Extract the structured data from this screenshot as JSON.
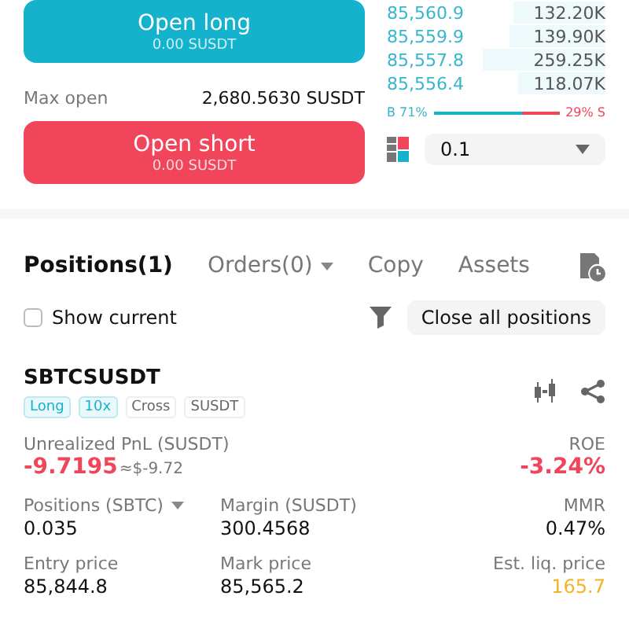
{
  "open_long": {
    "label": "Open long",
    "amount": "0.00 SUSDT"
  },
  "max_open": {
    "label": "Max open",
    "value": "2,680.5630 SUSDT"
  },
  "open_short": {
    "label": "Open short",
    "amount": "0.00 SUSDT"
  },
  "order_book": [
    {
      "price": "85,560.9",
      "size": "132.20K"
    },
    {
      "price": "85,559.9",
      "size": "139.90K"
    },
    {
      "price": "85,557.8",
      "size": "259.25K"
    },
    {
      "price": "85,556.4",
      "size": "118.07K"
    }
  ],
  "ratio": {
    "buy": "B 71%",
    "sell": "29% S",
    "level": 0.71
  },
  "precision": {
    "value": "0.1"
  },
  "tabs": [
    {
      "label": "Positions(1)",
      "selected": true,
      "dropdown": false
    },
    {
      "label": "Orders(0)",
      "selected": false,
      "dropdown": true
    },
    {
      "label": "Copy",
      "selected": false,
      "dropdown": false
    },
    {
      "label": "Assets",
      "selected": false,
      "dropdown": false
    }
  ],
  "show_current": {
    "label": "Show current",
    "checked": false
  },
  "close_all": "Close all positions",
  "position": {
    "symbol": "SBTCSUSDT",
    "tags": [
      {
        "label": "Long",
        "kind": "accent"
      },
      {
        "label": "10x",
        "kind": "accent"
      },
      {
        "label": "Cross",
        "kind": "plain"
      },
      {
        "label": "SUSDT",
        "kind": "plain"
      }
    ],
    "pnl_label": "Unrealized PnL (SUSDT)",
    "pnl": "-9.7195",
    "pnl_usd": "≈$-9.72",
    "roe_label": "ROE",
    "roe": "-3.24%",
    "fields": [
      {
        "label": "Positions (SBTC)",
        "value": "0.035",
        "dropdown": true,
        "kind": "plain"
      },
      {
        "label": "Margin (SUSDT)",
        "value": "300.4568",
        "dropdown": false,
        "kind": "plain"
      },
      {
        "label": "MMR",
        "value": "0.47%",
        "dropdown": false,
        "kind": "plain"
      },
      {
        "label": "Entry price",
        "value": "85,844.8",
        "dropdown": false,
        "kind": "plain"
      },
      {
        "label": "Mark price",
        "value": "85,565.2",
        "dropdown": false,
        "kind": "plain"
      },
      {
        "label": "Est. liq. price",
        "value": "165.7",
        "dropdown": false,
        "kind": "warn"
      }
    ]
  }
}
